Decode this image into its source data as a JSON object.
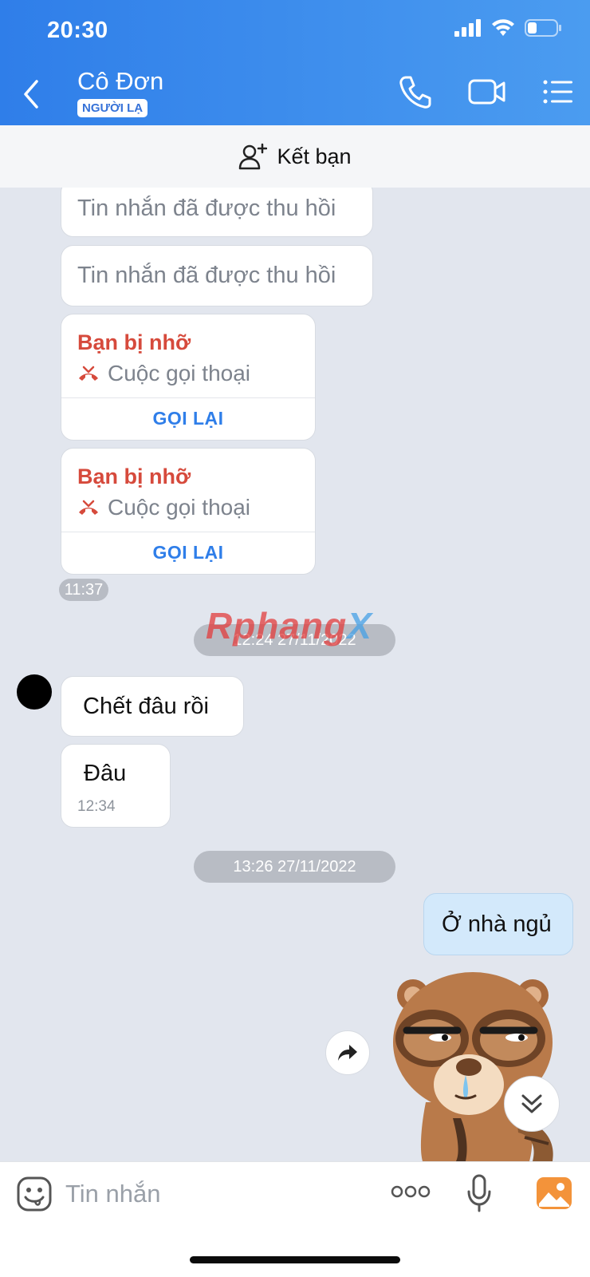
{
  "status_bar": {
    "time": "20:30"
  },
  "header": {
    "contact_name": "Cô Đơn",
    "badge": "NGƯỜI LẠ"
  },
  "friend_bar": {
    "label": "Kết bạn"
  },
  "messages": {
    "recalled_1": "Tin nhắn đã được thu hồi",
    "recalled_2": "Tin nhắn đã được thu hồi",
    "call_1": {
      "title": "Bạn bị nhỡ",
      "type": "Cuộc gọi thoại",
      "action": "GỌI LẠI"
    },
    "call_2": {
      "title": "Bạn bị nhỡ",
      "type": "Cuộc gọi thoại",
      "action": "GỌI LẠI"
    },
    "time_1": "11:37",
    "date_sep_1": "12:24 27/11/2022",
    "watermark_a": "Rphang",
    "watermark_b": "X",
    "received_1": "Chết đâu rồi",
    "received_2": "Đâu",
    "received_2_time": "12:34",
    "date_sep_2": "13:26 27/11/2022",
    "sent_1": "Ở nhà ngủ"
  },
  "input_bar": {
    "placeholder": "Tin nhắn"
  },
  "colors": {
    "header_start": "#2f7ee9",
    "header_end": "#4b9cf0",
    "missed_call": "#d64a3c",
    "callback": "#2f7ee9",
    "sent_bubble": "#d3e9fb"
  },
  "icons": [
    "back-icon",
    "phone-icon",
    "video-icon",
    "menu-icon",
    "add-friend-icon",
    "missed-call-icon",
    "forward-icon",
    "chevron-double-down-icon",
    "emoji-icon",
    "more-icon",
    "mic-icon",
    "image-icon"
  ]
}
